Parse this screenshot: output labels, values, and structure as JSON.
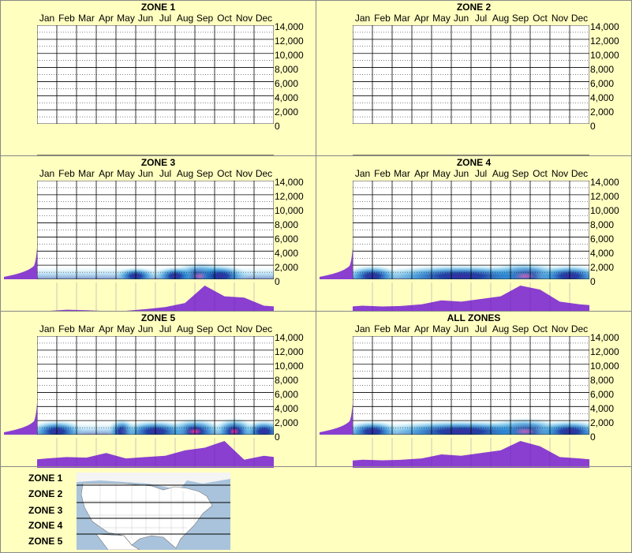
{
  "months": [
    "Jan",
    "Feb",
    "Mar",
    "Apr",
    "May",
    "Jun",
    "Jul",
    "Aug",
    "Sep",
    "Oct",
    "Nov",
    "Dec"
  ],
  "y_ticks": [
    "14,000",
    "12,000",
    "10,000",
    "8,000",
    "6,000",
    "4,000",
    "2,000",
    "0"
  ],
  "chart_data": [
    {
      "type": "heatmap",
      "title": "ZONE 1",
      "x": [
        "Jan",
        "Feb",
        "Mar",
        "Apr",
        "May",
        "Jun",
        "Jul",
        "Aug",
        "Sep",
        "Oct",
        "Nov",
        "Dec"
      ],
      "ylim": [
        0,
        14000
      ],
      "hot": [],
      "monthly": [
        0,
        0,
        0,
        0,
        0,
        0,
        0,
        0,
        0,
        0,
        0,
        0
      ],
      "has_left_hist": false
    },
    {
      "type": "heatmap",
      "title": "ZONE 2",
      "x": [
        "Jan",
        "Feb",
        "Mar",
        "Apr",
        "May",
        "Jun",
        "Jul",
        "Aug",
        "Sep",
        "Oct",
        "Nov",
        "Dec"
      ],
      "ylim": [
        0,
        14000
      ],
      "hot": [],
      "monthly": [
        0,
        0,
        0,
        0,
        0,
        0,
        0,
        0,
        0,
        0,
        0,
        0
      ],
      "has_left_hist": false
    },
    {
      "type": "heatmap",
      "title": "ZONE 3",
      "x": [
        "Jan",
        "Feb",
        "Mar",
        "Apr",
        "May",
        "Jun",
        "Jul",
        "Aug",
        "Sep",
        "Oct",
        "Nov",
        "Dec"
      ],
      "ylim": [
        0,
        14000
      ],
      "hot": [
        {
          "m": 7.8,
          "i": 1.0,
          "w": 2.2
        },
        {
          "m": 8.8,
          "i": 0.6,
          "w": 2.0
        },
        {
          "m": 6.5,
          "i": 0.3,
          "w": 1.5
        },
        {
          "m": 4.5,
          "i": 0.15,
          "w": 1.5
        }
      ],
      "monthly": [
        0.05,
        0.1,
        0.08,
        0.05,
        0.06,
        0.12,
        0.2,
        0.35,
        1.0,
        0.6,
        0.55,
        0.25
      ],
      "has_left_hist": true
    },
    {
      "type": "heatmap",
      "title": "ZONE 4",
      "x": [
        "Jan",
        "Feb",
        "Mar",
        "Apr",
        "May",
        "Jun",
        "Jul",
        "Aug",
        "Sep",
        "Oct",
        "Nov",
        "Dec"
      ],
      "ylim": [
        0,
        14000
      ],
      "hot": [
        {
          "m": 8.2,
          "i": 1.0,
          "w": 3.0
        },
        {
          "m": 5.0,
          "i": 0.6,
          "w": 6.0
        },
        {
          "m": 0.5,
          "i": 0.5,
          "w": 2.0
        },
        {
          "m": 10.5,
          "i": 0.6,
          "w": 2.5
        }
      ],
      "monthly": [
        0.25,
        0.22,
        0.24,
        0.3,
        0.45,
        0.4,
        0.5,
        0.6,
        1.0,
        0.85,
        0.4,
        0.3
      ],
      "has_left_hist": true
    },
    {
      "type": "heatmap",
      "title": "ZONE 5",
      "x": [
        "Jan",
        "Feb",
        "Mar",
        "Apr",
        "May",
        "Jun",
        "Jul",
        "Aug",
        "Sep",
        "Oct",
        "Nov",
        "Dec"
      ],
      "ylim": [
        0,
        14000
      ],
      "hot": [
        {
          "m": 9.5,
          "i": 1.0,
          "w": 1.5
        },
        {
          "m": 7.5,
          "i": 0.9,
          "w": 2.0
        },
        {
          "m": 3.8,
          "i": 0.8,
          "w": 1.0
        },
        {
          "m": 0.5,
          "i": 0.6,
          "w": 2.0
        },
        {
          "m": 5.5,
          "i": 0.6,
          "w": 2.5
        },
        {
          "m": 11.0,
          "i": 0.6,
          "w": 1.5
        }
      ],
      "monthly": [
        0.35,
        0.4,
        0.38,
        0.55,
        0.35,
        0.4,
        0.45,
        0.65,
        0.75,
        1.0,
        0.3,
        0.45
      ],
      "has_left_hist": true
    },
    {
      "type": "heatmap",
      "title": "ALL ZONES",
      "x": [
        "Jan",
        "Feb",
        "Mar",
        "Apr",
        "May",
        "Jun",
        "Jul",
        "Aug",
        "Sep",
        "Oct",
        "Nov",
        "Dec"
      ],
      "ylim": [
        0,
        14000
      ],
      "hot": [
        {
          "m": 8.2,
          "i": 1.0,
          "w": 3.0
        },
        {
          "m": 5.0,
          "i": 0.6,
          "w": 6.0
        },
        {
          "m": 0.5,
          "i": 0.5,
          "w": 2.0
        },
        {
          "m": 10.5,
          "i": 0.6,
          "w": 2.5
        }
      ],
      "monthly": [
        0.3,
        0.28,
        0.3,
        0.35,
        0.5,
        0.45,
        0.55,
        0.65,
        1.0,
        0.8,
        0.4,
        0.35
      ],
      "has_left_hist": true
    }
  ],
  "legend": {
    "zones": [
      "ZONE 1",
      "ZONE 2",
      "ZONE 3",
      "ZONE 4",
      "ZONE 5"
    ]
  }
}
